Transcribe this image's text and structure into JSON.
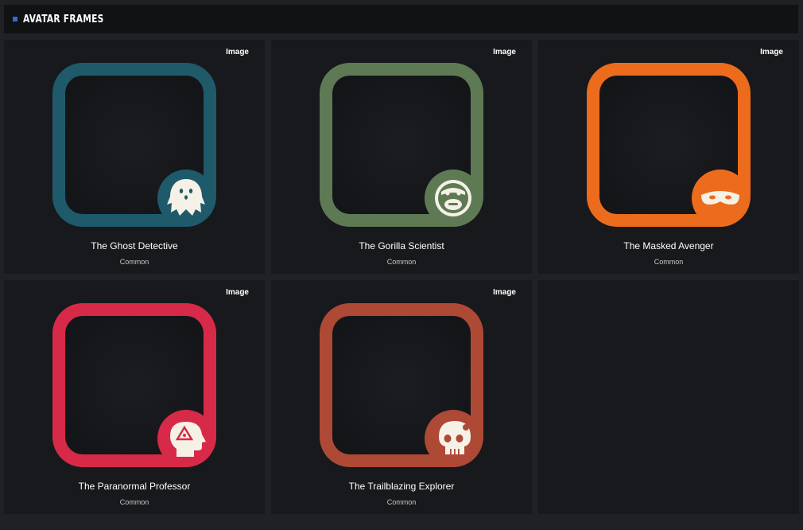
{
  "header": {
    "title": "AVATAR FRAMES"
  },
  "cards": [
    {
      "name": "The Ghost Detective",
      "rarity": "Common",
      "badge": "Image",
      "color": "#1e5a6a",
      "icon": "ghost-icon"
    },
    {
      "name": "The Gorilla Scientist",
      "rarity": "Common",
      "badge": "Image",
      "color": "#5e7a55",
      "icon": "gorilla-icon"
    },
    {
      "name": "The Masked Avenger",
      "rarity": "Common",
      "badge": "Image",
      "color": "#ec6b1c",
      "icon": "mask-icon"
    },
    {
      "name": "The Paranormal Professor",
      "rarity": "Common",
      "badge": "Image",
      "color": "#d72a48",
      "icon": "head-triangle-icon"
    },
    {
      "name": "The Trailblazing Explorer",
      "rarity": "Common",
      "badge": "Image",
      "color": "#ae4936",
      "icon": "skull-icon"
    }
  ]
}
